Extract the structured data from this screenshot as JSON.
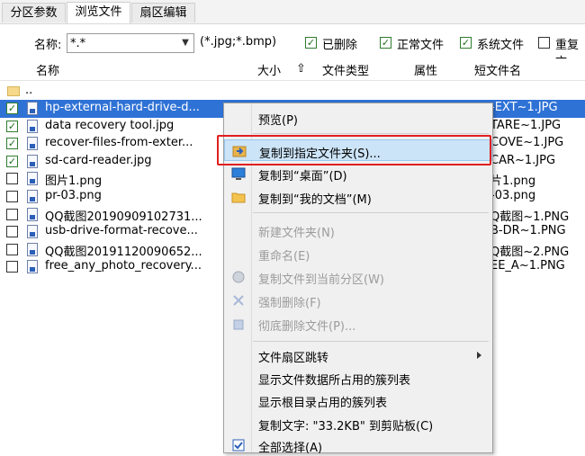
{
  "tabs": [
    {
      "label": "分区参数"
    },
    {
      "label": "浏览文件"
    },
    {
      "label": "扇区编辑"
    }
  ],
  "filter": {
    "name_label": "名称:",
    "name_value": "*.*",
    "pattern_hint": "(*.jpg;*.bmp)",
    "deleted_label": "已删除",
    "normal_label": "正常文件",
    "system_label": "系统文件",
    "duplicate_label": "重复文"
  },
  "columns": {
    "name": "名称",
    "size": "大小",
    "type": "文件类型",
    "attr": "属性",
    "short": "短文件名"
  },
  "parent_dir": "..",
  "files": [
    {
      "name": "hp-external-hard-drive-d...",
      "short": "-EXT~1.JPG",
      "checked": true,
      "selected": true
    },
    {
      "name": "data recovery tool.jpg",
      "short": "TARE~1.JPG",
      "checked": true,
      "selected": false
    },
    {
      "name": "recover-files-from-exter...",
      "short": "COVE~1.JPG",
      "checked": true,
      "selected": false
    },
    {
      "name": "sd-card-reader.jpg",
      "short": "CAR~1.JPG",
      "checked": true,
      "selected": false
    },
    {
      "name": "图片1.png",
      "short": "片1.png",
      "checked": false,
      "selected": false
    },
    {
      "name": "pr-03.png",
      "short": "-03.png",
      "checked": false,
      "selected": false
    },
    {
      "name": "QQ截图20190909102731...",
      "short": "Q截图~1.PNG",
      "checked": false,
      "selected": false
    },
    {
      "name": "usb-drive-format-recove...",
      "short": "B-DR~1.PNG",
      "checked": false,
      "selected": false
    },
    {
      "name": "QQ截图20191120090652...",
      "short": "Q截图~2.PNG",
      "checked": false,
      "selected": false
    },
    {
      "name": "free_any_photo_recovery...",
      "short": "EE_A~1.PNG",
      "checked": false,
      "selected": false
    }
  ],
  "context_menu": {
    "preview": "预览(P)",
    "copy_to_folder": "复制到指定文件夹(S)...",
    "copy_to_desktop": "复制到“桌面”(D)",
    "copy_to_documents": "复制到“我的文档”(M)",
    "new_folder": "新建文件夹(N)",
    "rename": "重命名(E)",
    "copy_to_partition": "复制文件到当前分区(W)",
    "force_delete": "强制删除(F)",
    "wipe_delete": "彻底删除文件(P)...",
    "sector_jump": "文件扇区跳转",
    "show_cluster_list": "显示文件数据所占用的簇列表",
    "show_root_cluster": "显示根目录占用的簇列表",
    "copy_text": "复制文字: \"33.2KB\" 到剪贴板(C)",
    "select_all": "全部选择(A)"
  },
  "colors": {
    "selection": "#2f72d6",
    "highlight_border": "#e02020",
    "menu_hover": "#cce4f7"
  }
}
